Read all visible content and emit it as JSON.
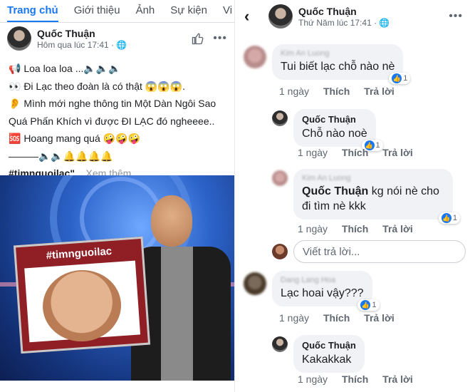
{
  "left": {
    "tabs": [
      "Trang chủ",
      "Giới thiệu",
      "Ảnh",
      "Sự kiện",
      "Vi"
    ],
    "post": {
      "author": "Quốc Thuận",
      "time": "Hôm qua lúc 17:41 ·",
      "lines": [
        "📢 Loa loa loa ...🔈🔈🔈",
        "👀 Đi Lạc theo đoàn là có thật 😱😱😱.",
        "👂 Mình mới nghe thông tin Một Dàn Ngôi Sao",
        "Quá Phấn Khích vì được ĐI LẠC đó ngheeee..",
        "🆘 Hoang mang quá 🤪🤪🤪",
        "———🔈🔈🔔🔔🔔🔔"
      ],
      "hashtag": "#timnguoilac\"...",
      "see_more": "Xem thêm",
      "frame_label": "#timnguoilac"
    }
  },
  "right": {
    "header": {
      "name": "Quốc Thuận",
      "time": "Thứ Năm lúc 17:41 ·"
    },
    "comments": [
      {
        "name": "Kim An Luong",
        "text": "Tui biết lạc chỗ nào nè",
        "react_count": "1",
        "time": "1 ngày",
        "like": "Thích",
        "reply": "Trả lời"
      },
      {
        "name": "Quốc Thuận",
        "text": "Chỗ nào noè",
        "react_count": "1",
        "time": "1 ngày",
        "like": "Thích",
        "reply": "Trả lời"
      },
      {
        "name": "Kim An Luong",
        "mention": "Quốc Thuận",
        "text": " kg nói nè cho đi tìm nè kkk",
        "react_count": "1",
        "time": "1 ngày",
        "like": "Thích",
        "reply": "Trả lời"
      },
      {
        "name": "Dang Lang Hoa",
        "text": "Lạc hoai vậy???",
        "react_count": "1",
        "time": "1 ngày",
        "like": "Thích",
        "reply": "Trả lời"
      },
      {
        "name": "Quốc Thuận",
        "text": "Kakakkak",
        "time": "1 ngày",
        "like": "Thích",
        "reply": "Trả lời"
      }
    ],
    "reply_placeholder": "Viết trả lời..."
  },
  "colors": {
    "accent": "#1877f2",
    "bubble": "#f0f2f5"
  }
}
